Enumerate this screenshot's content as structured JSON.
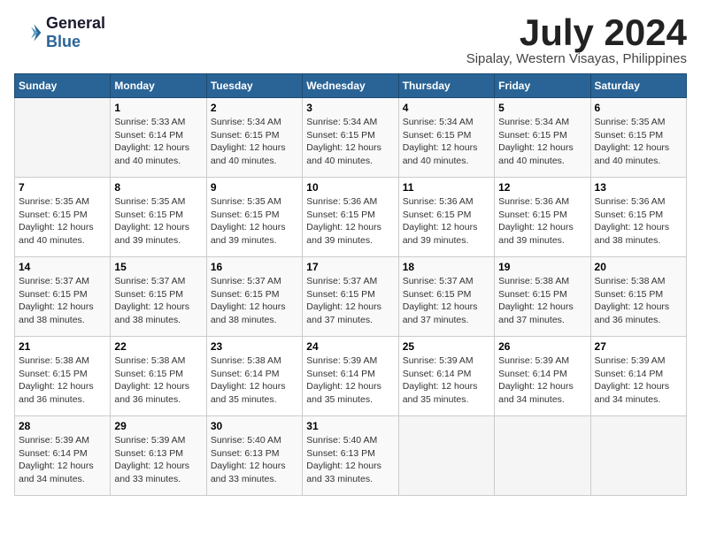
{
  "header": {
    "logo_line1": "General",
    "logo_line2": "Blue",
    "month_year": "July 2024",
    "location": "Sipalay, Western Visayas, Philippines"
  },
  "days_of_week": [
    "Sunday",
    "Monday",
    "Tuesday",
    "Wednesday",
    "Thursday",
    "Friday",
    "Saturday"
  ],
  "weeks": [
    [
      {
        "day": "",
        "info": ""
      },
      {
        "day": "1",
        "info": "Sunrise: 5:33 AM\nSunset: 6:14 PM\nDaylight: 12 hours\nand 40 minutes."
      },
      {
        "day": "2",
        "info": "Sunrise: 5:34 AM\nSunset: 6:15 PM\nDaylight: 12 hours\nand 40 minutes."
      },
      {
        "day": "3",
        "info": "Sunrise: 5:34 AM\nSunset: 6:15 PM\nDaylight: 12 hours\nand 40 minutes."
      },
      {
        "day": "4",
        "info": "Sunrise: 5:34 AM\nSunset: 6:15 PM\nDaylight: 12 hours\nand 40 minutes."
      },
      {
        "day": "5",
        "info": "Sunrise: 5:34 AM\nSunset: 6:15 PM\nDaylight: 12 hours\nand 40 minutes."
      },
      {
        "day": "6",
        "info": "Sunrise: 5:35 AM\nSunset: 6:15 PM\nDaylight: 12 hours\nand 40 minutes."
      }
    ],
    [
      {
        "day": "7",
        "info": "Sunrise: 5:35 AM\nSunset: 6:15 PM\nDaylight: 12 hours\nand 40 minutes."
      },
      {
        "day": "8",
        "info": "Sunrise: 5:35 AM\nSunset: 6:15 PM\nDaylight: 12 hours\nand 39 minutes."
      },
      {
        "day": "9",
        "info": "Sunrise: 5:35 AM\nSunset: 6:15 PM\nDaylight: 12 hours\nand 39 minutes."
      },
      {
        "day": "10",
        "info": "Sunrise: 5:36 AM\nSunset: 6:15 PM\nDaylight: 12 hours\nand 39 minutes."
      },
      {
        "day": "11",
        "info": "Sunrise: 5:36 AM\nSunset: 6:15 PM\nDaylight: 12 hours\nand 39 minutes."
      },
      {
        "day": "12",
        "info": "Sunrise: 5:36 AM\nSunset: 6:15 PM\nDaylight: 12 hours\nand 39 minutes."
      },
      {
        "day": "13",
        "info": "Sunrise: 5:36 AM\nSunset: 6:15 PM\nDaylight: 12 hours\nand 38 minutes."
      }
    ],
    [
      {
        "day": "14",
        "info": "Sunrise: 5:37 AM\nSunset: 6:15 PM\nDaylight: 12 hours\nand 38 minutes."
      },
      {
        "day": "15",
        "info": "Sunrise: 5:37 AM\nSunset: 6:15 PM\nDaylight: 12 hours\nand 38 minutes."
      },
      {
        "day": "16",
        "info": "Sunrise: 5:37 AM\nSunset: 6:15 PM\nDaylight: 12 hours\nand 38 minutes."
      },
      {
        "day": "17",
        "info": "Sunrise: 5:37 AM\nSunset: 6:15 PM\nDaylight: 12 hours\nand 37 minutes."
      },
      {
        "day": "18",
        "info": "Sunrise: 5:37 AM\nSunset: 6:15 PM\nDaylight: 12 hours\nand 37 minutes."
      },
      {
        "day": "19",
        "info": "Sunrise: 5:38 AM\nSunset: 6:15 PM\nDaylight: 12 hours\nand 37 minutes."
      },
      {
        "day": "20",
        "info": "Sunrise: 5:38 AM\nSunset: 6:15 PM\nDaylight: 12 hours\nand 36 minutes."
      }
    ],
    [
      {
        "day": "21",
        "info": "Sunrise: 5:38 AM\nSunset: 6:15 PM\nDaylight: 12 hours\nand 36 minutes."
      },
      {
        "day": "22",
        "info": "Sunrise: 5:38 AM\nSunset: 6:15 PM\nDaylight: 12 hours\nand 36 minutes."
      },
      {
        "day": "23",
        "info": "Sunrise: 5:38 AM\nSunset: 6:14 PM\nDaylight: 12 hours\nand 35 minutes."
      },
      {
        "day": "24",
        "info": "Sunrise: 5:39 AM\nSunset: 6:14 PM\nDaylight: 12 hours\nand 35 minutes."
      },
      {
        "day": "25",
        "info": "Sunrise: 5:39 AM\nSunset: 6:14 PM\nDaylight: 12 hours\nand 35 minutes."
      },
      {
        "day": "26",
        "info": "Sunrise: 5:39 AM\nSunset: 6:14 PM\nDaylight: 12 hours\nand 34 minutes."
      },
      {
        "day": "27",
        "info": "Sunrise: 5:39 AM\nSunset: 6:14 PM\nDaylight: 12 hours\nand 34 minutes."
      }
    ],
    [
      {
        "day": "28",
        "info": "Sunrise: 5:39 AM\nSunset: 6:14 PM\nDaylight: 12 hours\nand 34 minutes."
      },
      {
        "day": "29",
        "info": "Sunrise: 5:39 AM\nSunset: 6:13 PM\nDaylight: 12 hours\nand 33 minutes."
      },
      {
        "day": "30",
        "info": "Sunrise: 5:40 AM\nSunset: 6:13 PM\nDaylight: 12 hours\nand 33 minutes."
      },
      {
        "day": "31",
        "info": "Sunrise: 5:40 AM\nSunset: 6:13 PM\nDaylight: 12 hours\nand 33 minutes."
      },
      {
        "day": "",
        "info": ""
      },
      {
        "day": "",
        "info": ""
      },
      {
        "day": "",
        "info": ""
      }
    ]
  ]
}
